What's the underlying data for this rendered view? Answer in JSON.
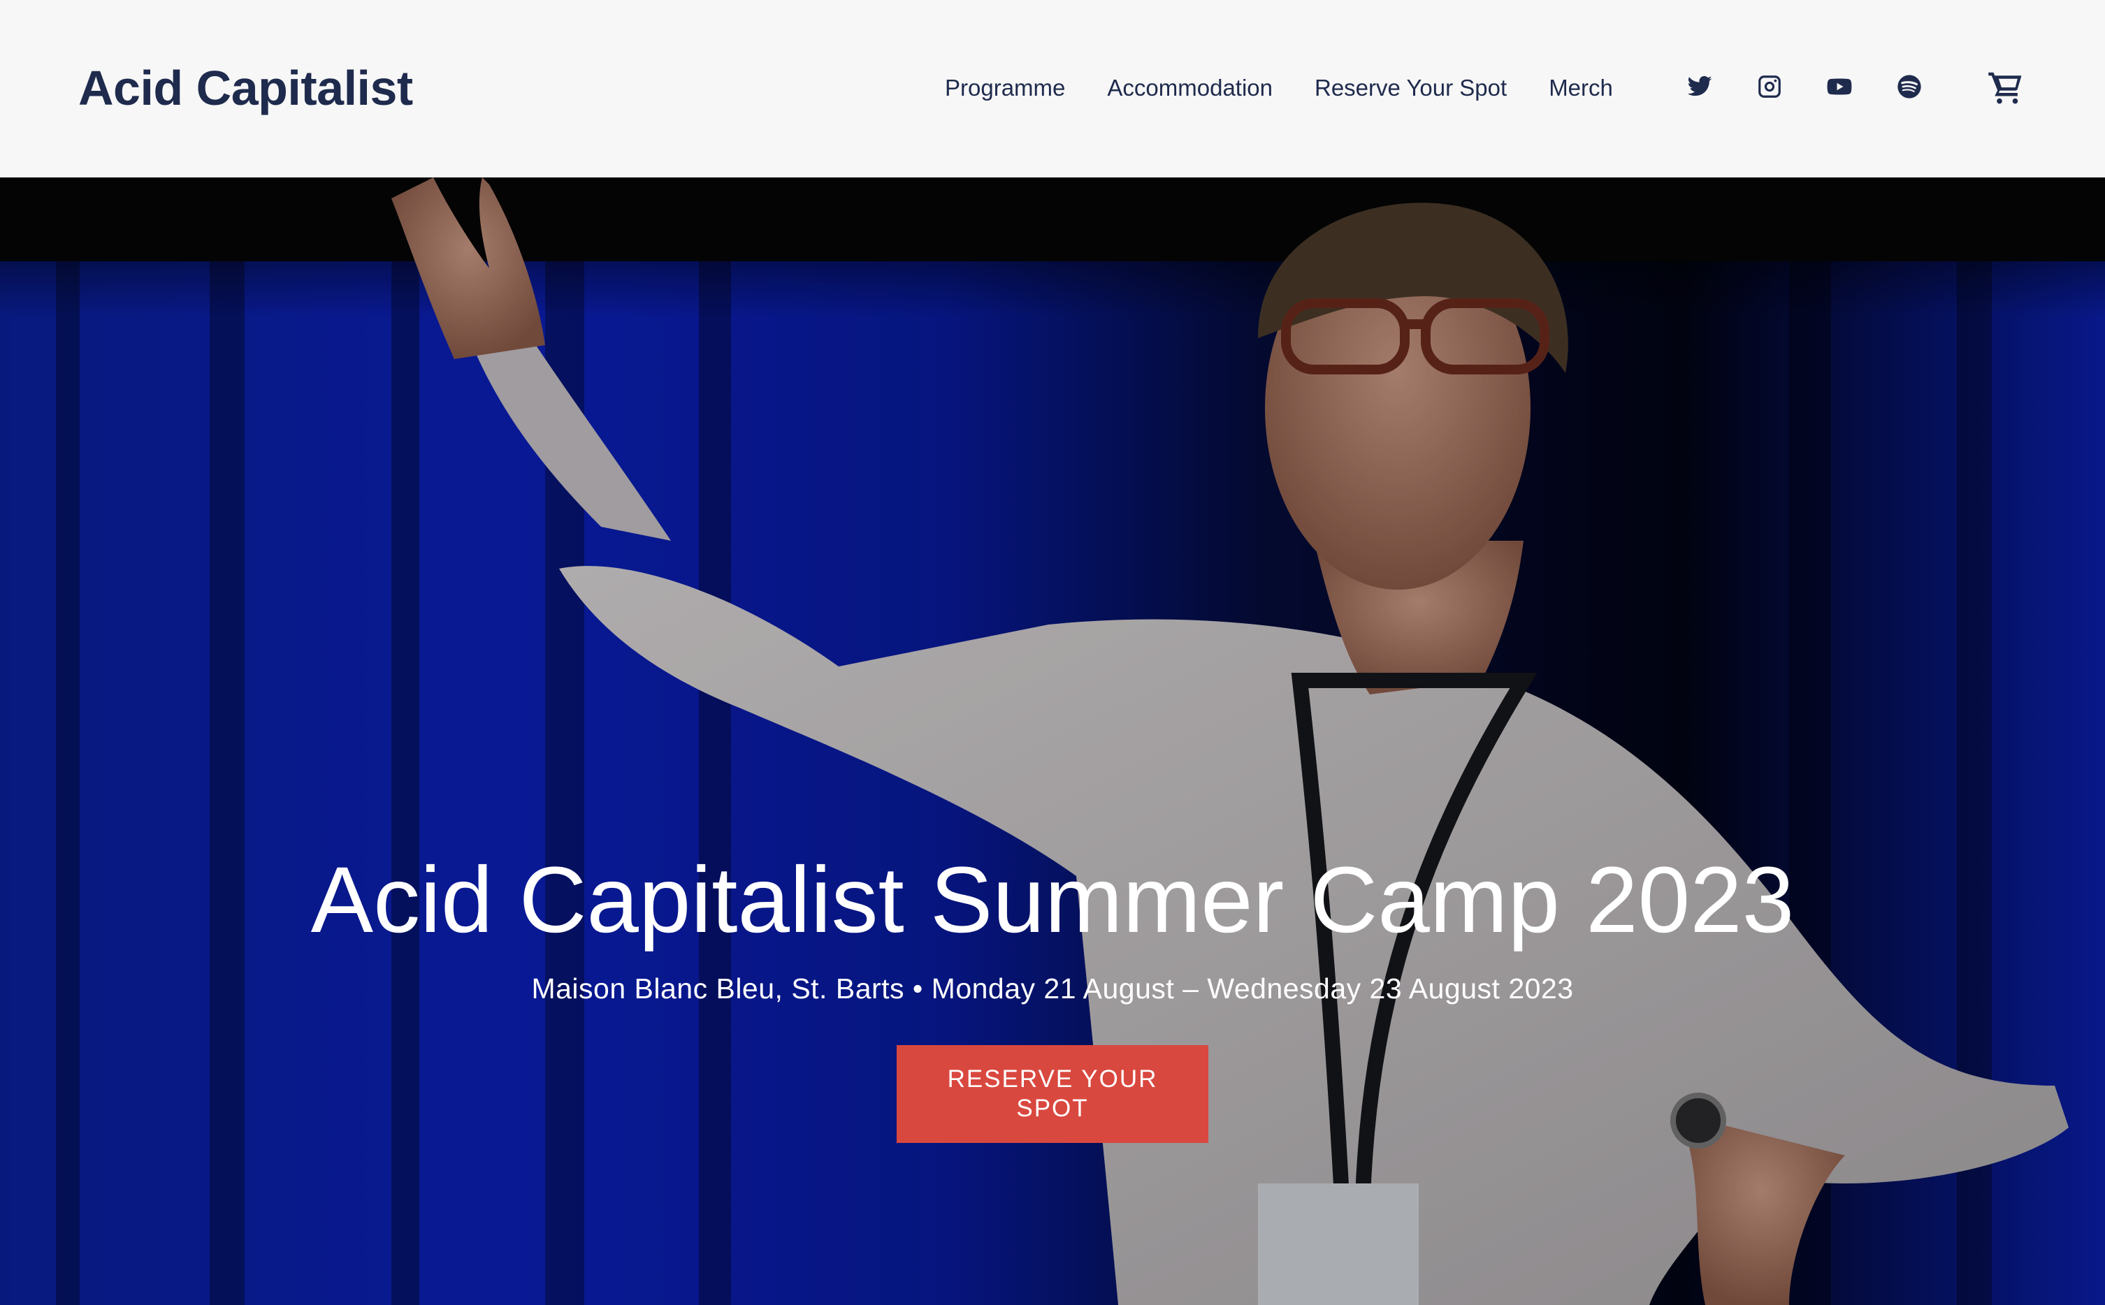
{
  "site": {
    "logo_text": "Acid Capitalist"
  },
  "nav": {
    "items": [
      {
        "label": "Programme"
      },
      {
        "label": "Accommodation"
      },
      {
        "label": "Reserve Your Spot"
      },
      {
        "label": "Merch"
      }
    ]
  },
  "social": {
    "icons": [
      "twitter-icon",
      "instagram-icon",
      "youtube-icon",
      "spotify-icon"
    ]
  },
  "cart": {
    "icon": "cart-icon"
  },
  "hero": {
    "title": "Acid Capitalist Summer Camp 2023",
    "subtitle": "Maison Blanc Bleu, St. Barts • Monday 21 August – Wednesday 23 August 2023",
    "cta_line1": "RESERVE YOUR",
    "cta_line2": "SPOT",
    "image": "speaker-on-stage-photo"
  },
  "colors": {
    "header_bg": "#f7f7f7",
    "brand_text": "#1f2b4d",
    "cta_bg": "#d9483f",
    "stage_blue": "#0a1aa8",
    "hero_text": "#ffffff"
  }
}
